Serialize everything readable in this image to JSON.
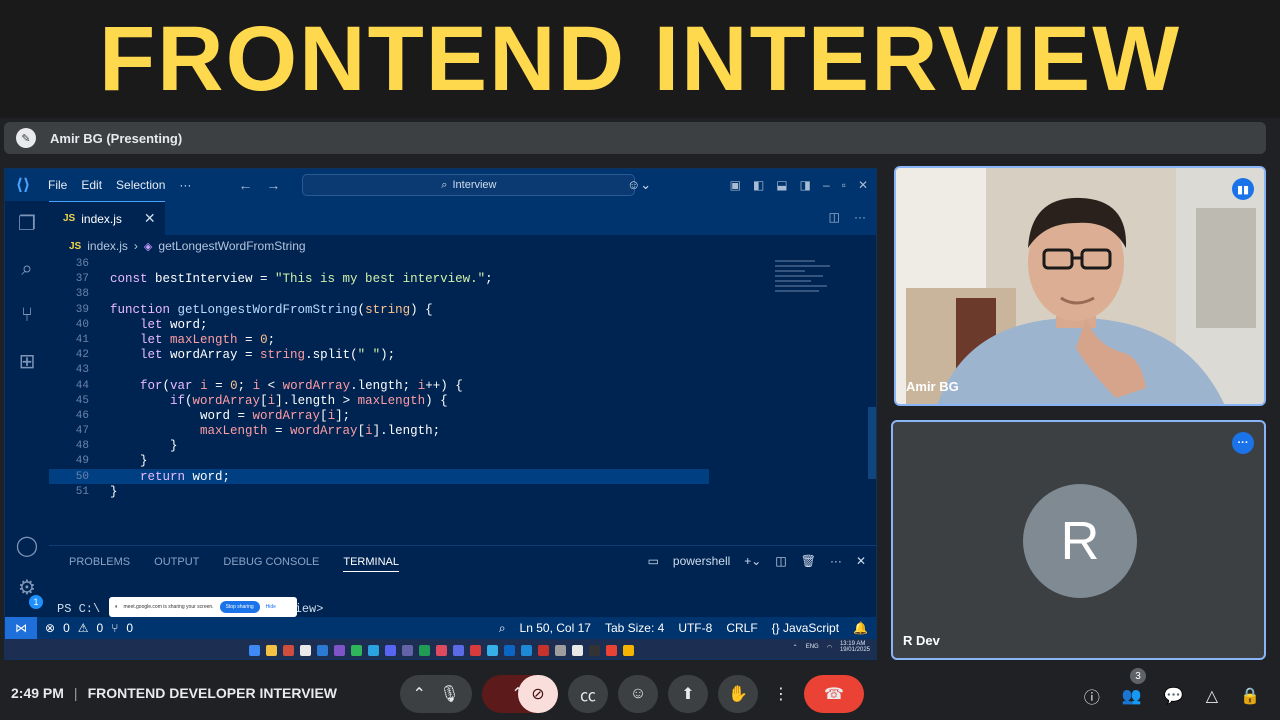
{
  "banner": {
    "title": "FRONTEND INTERVIEW"
  },
  "presenting": {
    "label": "Amir BG (Presenting)"
  },
  "vscode": {
    "menu": [
      "File",
      "Edit",
      "Selection",
      "···"
    ],
    "search_label": "Interview",
    "tab": {
      "icon": "JS",
      "name": "index.js"
    },
    "breadcrumb": {
      "file_icon": "JS",
      "file": "index.js",
      "symbol": "getLongestWordFromString"
    },
    "line_numbers": [
      "36",
      "37",
      "38",
      "39",
      "40",
      "41",
      "42",
      "43",
      "44",
      "45",
      "46",
      "47",
      "48",
      "49",
      "50",
      "51"
    ],
    "panel_tabs": [
      "PROBLEMS",
      "OUTPUT",
      "DEBUG CONSOLE",
      "TERMINAL"
    ],
    "terminal_shell": "powershell",
    "terminal_line": "PS C:\\",
    "terminal_path_end": "rview>",
    "share_popup": {
      "text": "meet.google.com is sharing your screen.",
      "stop": "Stop sharing",
      "hide": "Hide"
    },
    "status": {
      "errors": "0",
      "warnings": "0",
      "ports": "0",
      "position": "Ln 50, Col 17",
      "tab_size": "Tab Size: 4",
      "encoding": "UTF-8",
      "eol": "CRLF",
      "language": "JavaScript"
    },
    "taskbar": {
      "lang": "ENG",
      "time": "13:19 AM",
      "date": "19/01/2025"
    }
  },
  "participants": [
    {
      "name": "Amir BG"
    },
    {
      "name": "R Dev",
      "initial": "R"
    }
  ],
  "meeting": {
    "time": "2:49 PM",
    "separator": "|",
    "title": "FRONTEND DEVELOPER INTERVIEW",
    "people_count": "3"
  }
}
